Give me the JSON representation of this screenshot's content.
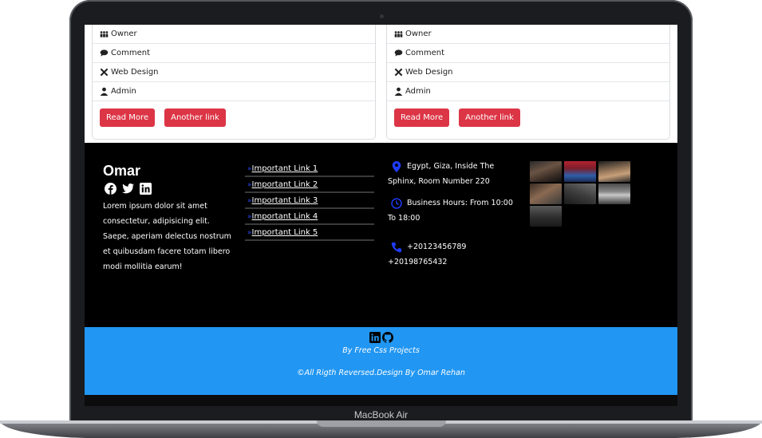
{
  "device": {
    "label": "MacBook Air"
  },
  "cards": [
    {
      "items": [
        {
          "icon": "users-icon",
          "label": "Owner"
        },
        {
          "icon": "comment-icon",
          "label": "Comment"
        },
        {
          "icon": "tools-icon",
          "label": "Web Design"
        },
        {
          "icon": "user-icon",
          "label": "Admin"
        }
      ],
      "buttons": [
        "Read More",
        "Another link"
      ]
    },
    {
      "items": [
        {
          "icon": "users-icon",
          "label": "Owner"
        },
        {
          "icon": "comment-icon",
          "label": "Comment"
        },
        {
          "icon": "tools-icon",
          "label": "Web Design"
        },
        {
          "icon": "user-icon",
          "label": "Admin"
        }
      ],
      "buttons": [
        "Read More",
        "Another link"
      ]
    }
  ],
  "footer": {
    "brand": "Omar",
    "social_icons": [
      "facebook-icon",
      "twitter-icon",
      "linkedin-icon"
    ],
    "about": "Lorem ipsum dolor sit amet consectetur, adipisicing elit. Saepe, aperiam delectus nostrum et quibusdam facere totam libero modi mollitia earum!",
    "links": [
      "Important Link 1",
      "Important Link 2",
      "Important Link 3",
      "Important Link 4",
      "Important Link 5"
    ],
    "contact": {
      "address": "Egypt, Giza, Inside The Sphinx, Room Number 220",
      "hours": "Business Hours: From 10:00 To 18:00",
      "phones": "+20123456789 +20198765432"
    },
    "gallery_count": 7
  },
  "bottom": {
    "icons": [
      "linkedin-icon",
      "github-icon"
    ],
    "by": "By Free Css Projects",
    "rights": "©All Rigth Reversed.Design By Omar Rehan"
  },
  "colors": {
    "accent": "#2196f3",
    "button": "#dc3545",
    "link_chevron": "#2f4cff",
    "footer_bg": "#000000"
  }
}
